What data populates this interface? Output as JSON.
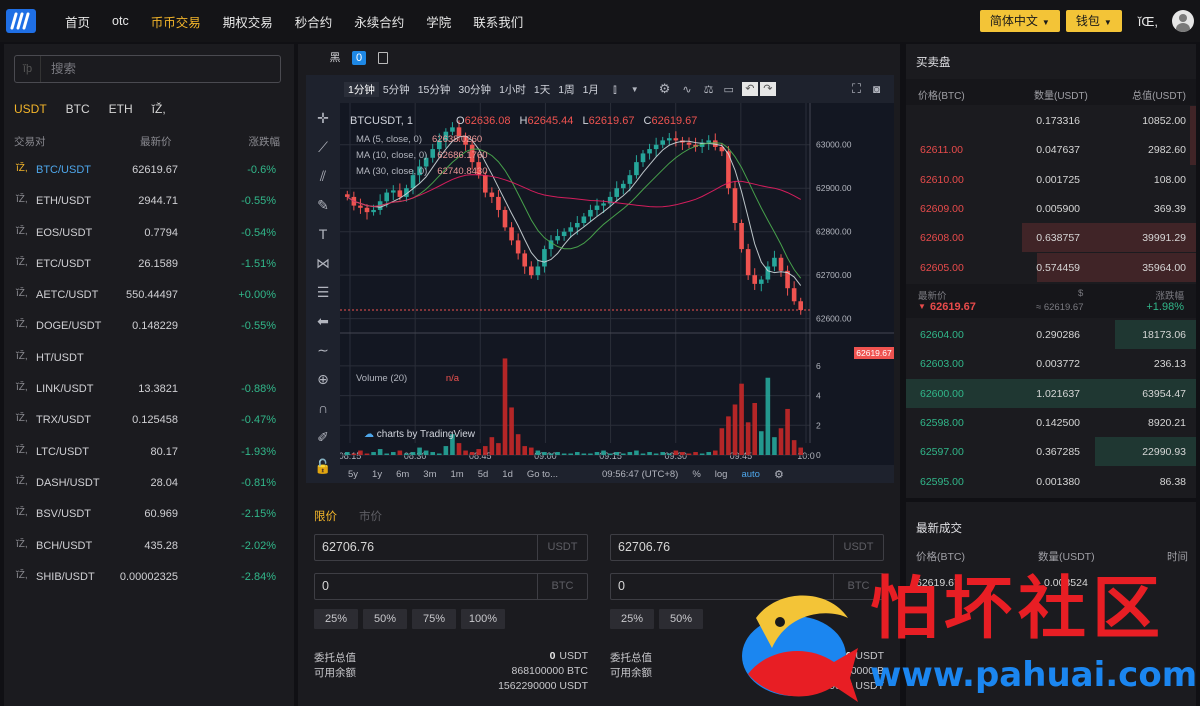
{
  "nav": {
    "items": [
      "首页",
      "otc",
      "币币交易",
      "期权交易",
      "秒合约",
      "永续合约",
      "学院",
      "联系我们"
    ],
    "active_index": 2,
    "language_label": "简体中文",
    "wallet_label": "钱包",
    "user_label": "ĭŒ,"
  },
  "market": {
    "search_placeholder": "搜索",
    "search_icon_glyph": "ĭþ",
    "tabs": [
      "USDT",
      "BTC",
      "ETH",
      "ĭŽ,"
    ],
    "active_tab": 0,
    "columns": [
      "交易对",
      "最新价",
      "涨跌幅"
    ],
    "rows": [
      {
        "fav": "ĭŽ,",
        "pair": "BTC/USDT",
        "price": "62619.67",
        "change": "-0.6%",
        "dir": "down",
        "active": true
      },
      {
        "fav": "ĭŽ,",
        "pair": "ETH/USDT",
        "price": "2944.71",
        "change": "-0.55%",
        "dir": "down"
      },
      {
        "fav": "ĭŽ,",
        "pair": "EOS/USDT",
        "price": "0.7794",
        "change": "-0.54%",
        "dir": "down"
      },
      {
        "fav": "ĭŽ,",
        "pair": "ETC/USDT",
        "price": "26.1589",
        "change": "-1.51%",
        "dir": "down"
      },
      {
        "fav": "ĭŽ,",
        "pair": "AETC/USDT",
        "price": "550.44497",
        "change": "+0.00%",
        "dir": "up"
      },
      {
        "fav": "ĭŽ,",
        "pair": "DOGE/USDT",
        "price": "0.148229",
        "change": "-0.55%",
        "dir": "down"
      },
      {
        "fav": "ĭŽ,",
        "pair": "HT/USDT",
        "price": "",
        "change": "",
        "dir": "down"
      },
      {
        "fav": "ĭŽ,",
        "pair": "LINK/USDT",
        "price": "13.3821",
        "change": "-0.88%",
        "dir": "down"
      },
      {
        "fav": "ĭŽ,",
        "pair": "TRX/USDT",
        "price": "0.125458",
        "change": "-0.47%",
        "dir": "down"
      },
      {
        "fav": "ĭŽ,",
        "pair": "LTC/USDT",
        "price": "80.17",
        "change": "-1.93%",
        "dir": "down"
      },
      {
        "fav": "ĭŽ,",
        "pair": "DASH/USDT",
        "price": "28.04",
        "change": "-0.81%",
        "dir": "down"
      },
      {
        "fav": "ĭŽ,",
        "pair": "BSV/USDT",
        "price": "60.969",
        "change": "-2.15%",
        "dir": "down"
      },
      {
        "fav": "ĭŽ,",
        "pair": "BCH/USDT",
        "price": "435.28",
        "change": "-2.02%",
        "dir": "down"
      },
      {
        "fav": "ĭŽ,",
        "pair": "SHIB/USDT",
        "price": "0.00002325",
        "change": "-2.84%",
        "dir": "down"
      }
    ]
  },
  "chart": {
    "view_tabs": [
      "黑",
      "0"
    ],
    "timeframes": [
      "1分钟",
      "5分钟",
      "15分钟",
      "30分钟",
      "1小时",
      "1天",
      "1周",
      "1月"
    ],
    "active_timeframe": 0,
    "symbol": "BTCUSDT, 1",
    "ohlc": {
      "o_label": "O",
      "o": "62636.08",
      "h_label": "H",
      "h": "62645.44",
      "l_label": "L",
      "l": "62619.67",
      "c_label": "C",
      "c": "62619.67"
    },
    "ma_lines": [
      {
        "label": "MA (5, close, 0)",
        "value": "62638.0260"
      },
      {
        "label": "MA (10, close, 0)",
        "value": "62686.1760"
      },
      {
        "label": "MA (30, close, 0)",
        "value": "62740.8430"
      }
    ],
    "volume_legend": "Volume (20)",
    "volume_na": "n/a",
    "credit": "charts by TradingView",
    "last_price_tag": "62619.67",
    "time_labels": [
      "08:15",
      "08:30",
      "08:45",
      "09:00",
      "09:15",
      "09:30",
      "09:45",
      "10:0"
    ],
    "range_buttons": [
      "5y",
      "1y",
      "6m",
      "3m",
      "1m",
      "5d",
      "1d",
      "Go to..."
    ],
    "clock": "09:56:47 (UTC+8)",
    "scale_options": [
      "%",
      "log",
      "auto"
    ],
    "colors": {
      "up": "#26a69a",
      "down": "#ef5350",
      "ma5": "#cfd8dc",
      "ma10": "#4caf50",
      "ma30": "#e91e63"
    }
  },
  "chart_data": {
    "type": "candlestick",
    "title": "BTCUSDT, 1",
    "x_ticks": [
      "08:15",
      "08:30",
      "08:45",
      "09:00",
      "09:15",
      "09:30",
      "09:45",
      "10:0"
    ],
    "y_ticks": [
      62600,
      62700,
      62800,
      62900,
      63000
    ],
    "ylim": [
      62590,
      63050
    ],
    "volume_ticks": [
      0,
      2,
      4,
      6
    ],
    "volume_ylim": [
      0,
      7
    ],
    "close_series": [
      62880,
      62860,
      62855,
      62845,
      62850,
      62870,
      62890,
      62895,
      62880,
      62900,
      62930,
      62950,
      62970,
      62990,
      63010,
      63030,
      63040,
      63020,
      63000,
      62960,
      62930,
      62890,
      62880,
      62850,
      62810,
      62780,
      62750,
      62720,
      62700,
      62720,
      62760,
      62780,
      62790,
      62800,
      62810,
      62820,
      62835,
      62850,
      62860,
      62865,
      62880,
      62900,
      62910,
      62930,
      62960,
      62980,
      62990,
      63000,
      63010,
      63015,
      63010,
      63005,
      63000,
      62995,
      63005,
      63010,
      62995,
      62985,
      62900,
      62820,
      62760,
      62700,
      62680,
      62690,
      62720,
      62740,
      62710,
      62670,
      62640,
      62620
    ],
    "volume_series": [
      0.2,
      0.1,
      0.3,
      0.1,
      0.2,
      0.4,
      0.1,
      0.2,
      0.3,
      0.1,
      0.2,
      0.5,
      0.3,
      0.2,
      0.1,
      0.6,
      1.4,
      0.8,
      0.3,
      0.2,
      0.4,
      0.6,
      1.2,
      0.8,
      6.5,
      3.2,
      1.4,
      0.6,
      0.5,
      0.3,
      0.2,
      0.1,
      0.2,
      0.1,
      0.1,
      0.2,
      0.1,
      0.1,
      0.2,
      0.3,
      0.1,
      0.2,
      0.1,
      0.2,
      0.3,
      0.1,
      0.2,
      0.1,
      0.2,
      0.1,
      0.3,
      0.2,
      0.1,
      0.2,
      0.1,
      0.2,
      0.3,
      1.8,
      2.6,
      3.4,
      4.8,
      2.2,
      3.5,
      1.6,
      5.2,
      1.2,
      1.8,
      3.1,
      1.0,
      0.5
    ]
  },
  "order": {
    "tabs": [
      "限价",
      "市价"
    ],
    "active_tab": 0,
    "buy": {
      "price": "62706.76",
      "price_unit": "USDT",
      "amount": "0",
      "amount_unit": "BTC",
      "pcts": [
        "25%",
        "50%",
        "75%",
        "100%"
      ],
      "total_label": "委托总值",
      "total_value": "0",
      "total_unit": "USDT",
      "avail_label": "可用余额",
      "avail_btc": "868100000 BTC",
      "avail_usdt": "1562290000 USDT"
    },
    "sell": {
      "price": "62706.76",
      "price_unit": "USDT",
      "amount": "0",
      "amount_unit": "BTC",
      "pcts": [
        "25%",
        "50%"
      ],
      "total_label": "委托总值",
      "total_value": "0",
      "total_unit": "USDT",
      "avail_label": "可用余额",
      "avail_btc": "868100000 B",
      "avail_usdt": "1562290000 USDT"
    }
  },
  "orderbook": {
    "title": "买卖盘",
    "columns": [
      "价格(BTC)",
      "数量(USDT)",
      "总值(USDT)"
    ],
    "asks": [
      {
        "price": "",
        "amount": "0.173316",
        "total": "10852.00",
        "depth": 0.02
      },
      {
        "price": "62611.00",
        "amount": "0.047637",
        "total": "2982.60",
        "depth": 0.02
      },
      {
        "price": "62610.00",
        "amount": "0.001725",
        "total": "108.00",
        "depth": 0.0
      },
      {
        "price": "62609.00",
        "amount": "0.005900",
        "total": "369.39",
        "depth": 0.0
      },
      {
        "price": "62608.00",
        "amount": "0.638757",
        "total": "39991.29",
        "depth": 0.6
      },
      {
        "price": "62605.00",
        "amount": "0.574459",
        "total": "35964.00",
        "depth": 0.55
      }
    ],
    "mid": {
      "label_left": "最新价",
      "label_center": "$",
      "label_right": "涨跌幅",
      "price": "62619.67",
      "usd": "≈ 62619.67",
      "change": "+1.98%"
    },
    "bids": [
      {
        "price": "62604.00",
        "amount": "0.290286",
        "total": "18173.06",
        "depth": 0.28
      },
      {
        "price": "62603.00",
        "amount": "0.003772",
        "total": "236.13",
        "depth": 0.0
      },
      {
        "price": "62600.00",
        "amount": "1.021637",
        "total": "63954.47",
        "depth": 1.0
      },
      {
        "price": "62598.00",
        "amount": "0.142500",
        "total": "8920.21",
        "depth": 0.0
      },
      {
        "price": "62597.00",
        "amount": "0.367285",
        "total": "22990.93",
        "depth": 0.35
      },
      {
        "price": "62595.00",
        "amount": "0.001380",
        "total": "86.38",
        "depth": 0.0
      }
    ]
  },
  "trades": {
    "title": "最新成交",
    "columns": [
      "价格(BTC)",
      "数量(USDT)",
      "时间"
    ],
    "rows": [
      {
        "price": "62619.67",
        "amount": "0.003524"
      }
    ]
  },
  "watermark": {
    "text": "怕坏社区",
    "url": "www.pahuai.com"
  }
}
